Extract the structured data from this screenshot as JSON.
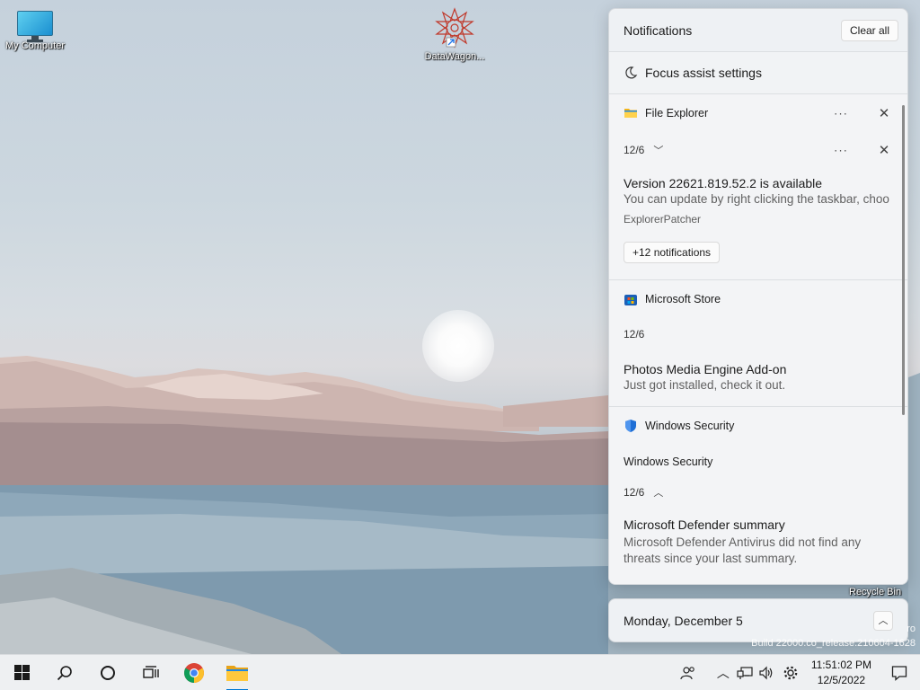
{
  "desktop": {
    "icons": [
      {
        "label": "My Computer"
      },
      {
        "label": "DataWagon..."
      }
    ],
    "recycle_bin": "Recycle Bin",
    "watermark_line1": "ro",
    "watermark_line2": "Build 22000.co_release.210604-1628"
  },
  "notifications": {
    "title": "Notifications",
    "clear_all": "Clear all",
    "focus_assist": "Focus assist settings",
    "groups": [
      {
        "app": "File Explorer",
        "date": "12/6",
        "title": "Version 22621.819.52.2 is available",
        "body": "You can update by right clicking the taskbar, choo",
        "source": "ExplorerPatcher",
        "more": "+12 notifications"
      },
      {
        "app": "Microsoft Store",
        "date": "12/6",
        "title": "Photos Media Engine Add-on",
        "body": "Just got installed, check it out."
      },
      {
        "app": "Windows Security",
        "subtitle": "Windows Security",
        "date": "12/6",
        "title": "Microsoft Defender summary",
        "body": "Microsoft Defender Antivirus did not find any threats since your last summary."
      }
    ]
  },
  "calendar": {
    "date": "Monday, December 5"
  },
  "taskbar": {
    "time": "11:51:02 PM",
    "date": "12/5/2022"
  },
  "icons": {
    "start": "windows-start-icon",
    "search": "search-icon",
    "cortana": "cortana-icon",
    "task_view": "task-view-icon",
    "chrome": "chrome-icon",
    "explorer": "folder-icon"
  },
  "colors": {
    "accent": "#0078d4",
    "panel_bg": "#eef1f4",
    "shield": "#1f6fd6"
  }
}
